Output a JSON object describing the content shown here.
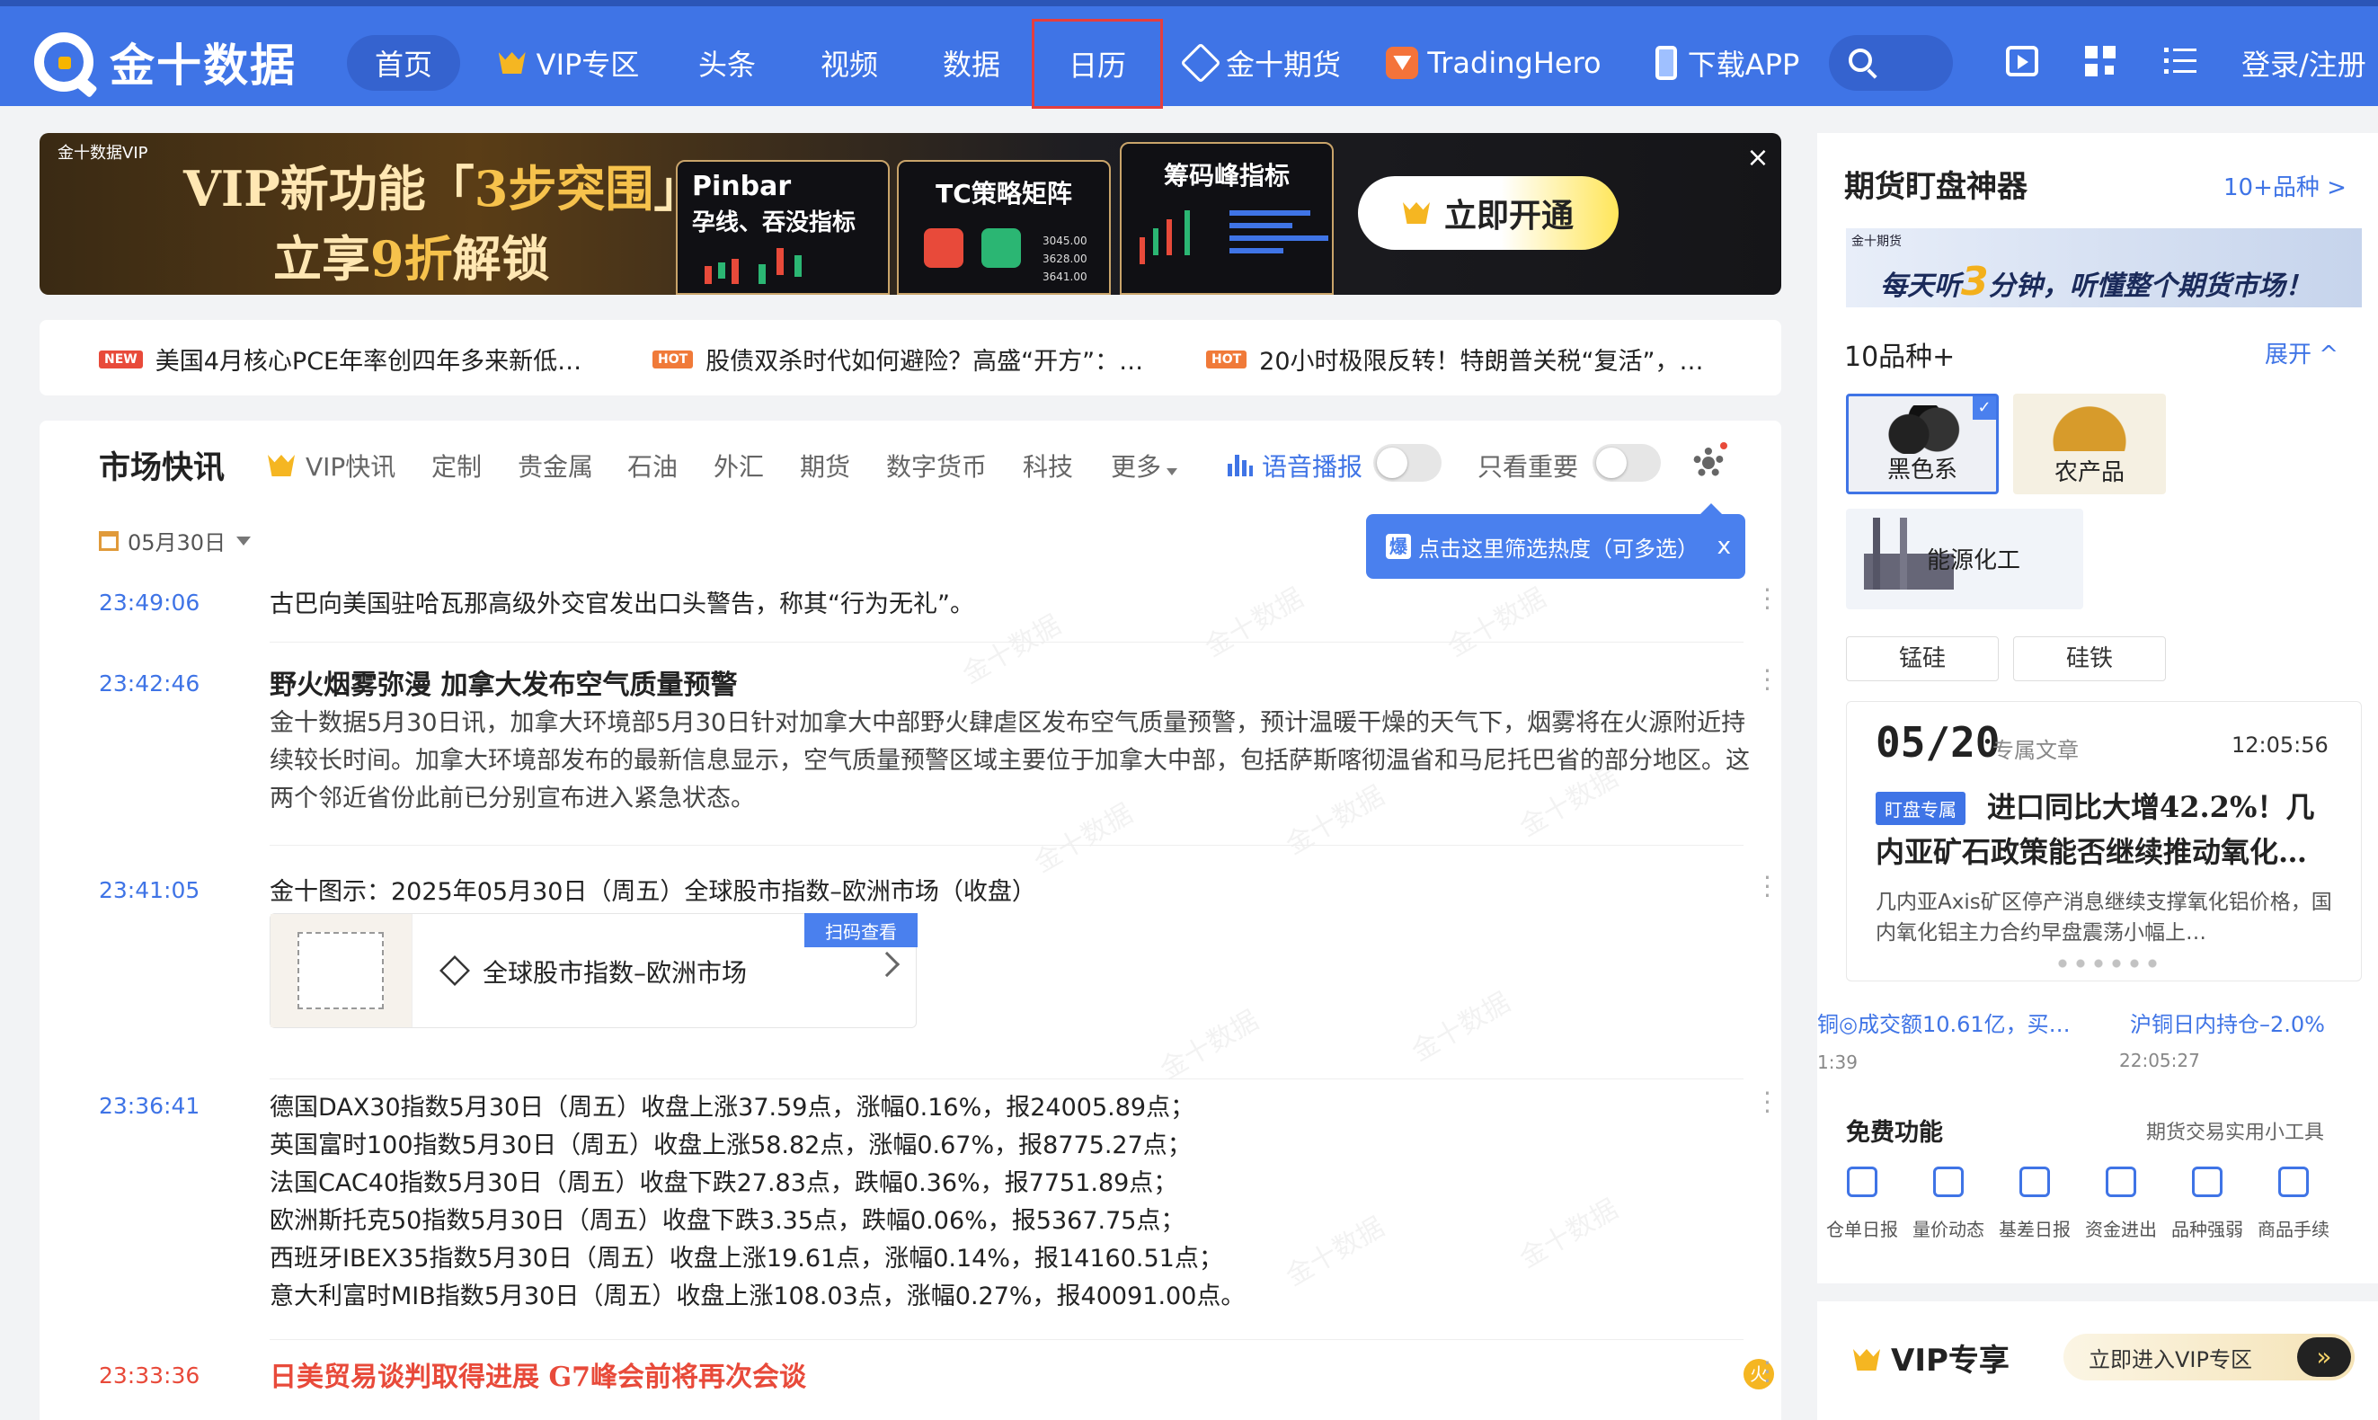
{
  "header": {
    "logo_text": "金十数据",
    "nav": [
      "首页",
      "VIP专区",
      "头条",
      "视频",
      "数据",
      "日历",
      "金十期货",
      "TradingHero",
      "下载APP"
    ],
    "login": "登录/注册"
  },
  "banner": {
    "brand": "金十数据VIP",
    "line1_a": "VIP新功能「",
    "line1_b": "3步突围",
    "line1_c": "」",
    "line2_a": "立享",
    "line2_b": "9折",
    "line2_c": "解锁",
    "card1_title": "Pinbar",
    "card1_sub": "孕线、吞没指标",
    "card2_title": "TC策略矩阵",
    "card2_nums": [
      "3045.00",
      "3628.00",
      "3641.00"
    ],
    "card3_title": "筹码峰指标",
    "cta": "立即开通",
    "close": "×"
  },
  "ticker": [
    {
      "badge": "NEW",
      "text": "美国4月核心PCE年率创四年多来新低…"
    },
    {
      "badge": "HOT",
      "text": "股债双杀时代如何避险？高盛“开方”：…"
    },
    {
      "badge": "HOT",
      "text": "20小时极限反转！特朗普关税“复活”，…"
    }
  ],
  "feed": {
    "title": "市场快讯",
    "tabs": [
      "VIP快讯",
      "定制",
      "贵金属",
      "石油",
      "外汇",
      "期货",
      "数字货币",
      "科技",
      "更多"
    ],
    "voice": "语音播报",
    "important": "只看重要",
    "tooltip_badge": "爆",
    "tooltip": "点击这里筛选热度（可多选）",
    "tooltip_close": "x",
    "date": "05月30日",
    "items": [
      {
        "time": "23:49:06",
        "text": "古巴向美国驻哈瓦那高级外交官发出口头警告，称其“行为无礼”。"
      },
      {
        "time": "23:42:46",
        "headline": "野火烟雾弥漫 加拿大发布空气质量预警",
        "body": "金十数据5月30日讯，加拿大环境部5月30日针对加拿大中部野火肆虐区发布空气质量预警，预计温暖干燥的天气下，烟雾将在火源附近持续较长时间。加拿大环境部发布的最新信息显示，空气质量预警区域主要位于加拿大中部，包括萨斯喀彻温省和马尼托巴省的部分地区。这两个邻近省份此前已分别宣布进入紧急状态。"
      },
      {
        "time": "23:41:05",
        "text": "金十图示：2025年05月30日（周五）全球股市指数–欧洲市场（收盘）",
        "card_text": "全球股市指数–欧洲市场",
        "card_scan": "扫码查看"
      },
      {
        "time": "23:36:41",
        "lines": [
          "德国DAX30指数5月30日（周五）收盘上涨37.59点，涨幅0.16%，报24005.89点；",
          "英国富时100指数5月30日（周五）收盘上涨58.82点，涨幅0.67%，报8775.27点；",
          "法国CAC40指数5月30日（周五）收盘下跌27.83点，跌幅0.36%，报7751.89点；",
          "欧洲斯托克50指数5月30日（周五）收盘下跌3.35点，跌幅0.06%，报5367.75点；",
          "西班牙IBEX35指数5月30日（周五）收盘上涨19.61点，涨幅0.14%，报14160.51点；",
          "意大利富时MIB指数5月30日（周五）收盘上涨108.03点，涨幅0.27%，报40091.00点。"
        ]
      },
      {
        "time": "23:33:36",
        "headline": "日美贸易谈判取得进展 G7峰会前将再次会谈",
        "fire": "火"
      }
    ],
    "watermark": "金十数据"
  },
  "sidebar": {
    "title": "期货盯盘神器",
    "more": "10+品种 >",
    "promo_small": "金十期货",
    "promo_a": "每天听",
    "promo_b": "3",
    "promo_c": "分钟，听懂整个期货市场！",
    "cat_title": "10品种+",
    "expand": "展开 ^",
    "cats": [
      "黑色系",
      "农产品",
      "能源化工"
    ],
    "pills": [
      "锰硅",
      "硅铁"
    ],
    "article": {
      "date": "05/20",
      "sub": "专属文章",
      "time": "12:05:56",
      "tag": "盯盘专属",
      "title": "进口同比大增42.2%！几内亚矿石政策能否继续推动氧化…",
      "desc": "几内亚Axis矿区停产消息继续支撑氧化铝价格，国内氧化铝主力合约早盘震荡小幅上…"
    },
    "marquee1": "铜◎成交额10.61亿，买…",
    "marquee2": "沪铜日内持仓–2.0%",
    "marquee1_time": "1:39",
    "marquee2_time": "22:05:27",
    "free_title": "免费功能",
    "free_sub": "期货交易实用小工具",
    "free": [
      "仓单日报",
      "量价动态",
      "基差日报",
      "资金进出",
      "品种强弱",
      "商品手续"
    ],
    "vip_title": "VIP专享",
    "vip_btn": "立即进入VIP专区",
    "vip_arrow": "»"
  }
}
